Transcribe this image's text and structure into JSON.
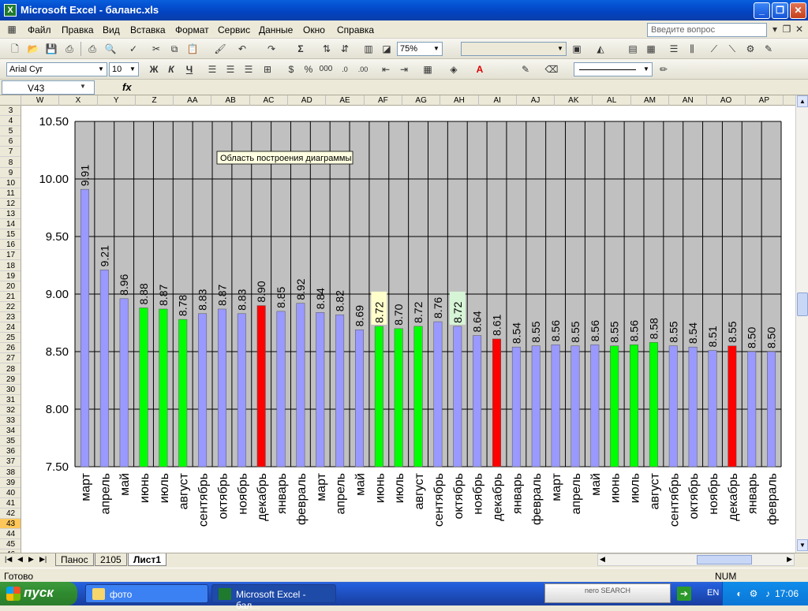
{
  "window": {
    "title": "Microsoft Excel - баланс.xls",
    "app_icon": "excel-icon",
    "buttons": [
      "minimize",
      "restore",
      "close"
    ]
  },
  "menu": {
    "items": [
      "Файл",
      "Правка",
      "Вид",
      "Вставка",
      "Формат",
      "Сервис",
      "Данные",
      "Окно",
      "Справка"
    ],
    "help_placeholder": "Введите вопрос"
  },
  "toolbar": {
    "zoom": "75%"
  },
  "format_toolbar": {
    "font": "Arial Cyr",
    "size": "10",
    "bold": "Ж",
    "italic": "К",
    "underline": "Ч"
  },
  "formula_bar": {
    "cell": "V43",
    "fx": "fx",
    "value": ""
  },
  "columns": [
    "W",
    "X",
    "Y",
    "Z",
    "AA",
    "AB",
    "AC",
    "AD",
    "AE",
    "AF",
    "AG",
    "AH",
    "AI",
    "AJ",
    "AK",
    "AL",
    "AM",
    "AN",
    "AO",
    "AP",
    "A"
  ],
  "rows_start": 3,
  "rows_end": 46,
  "selected_row": 43,
  "sheet_tabs": [
    "Панос",
    "2105",
    "Лист1"
  ],
  "active_tab": "Лист1",
  "status": {
    "ready": "Готово",
    "num": "NUM"
  },
  "taskbar": {
    "start": "пуск",
    "tasks": [
      "фото",
      "Microsoft Excel - бал..."
    ],
    "lang": "EN",
    "clock": "17:06",
    "nero": "nero SEARCH"
  },
  "tooltip": "Область построения диаграммы",
  "colors": {
    "bar_default": "#9999ff",
    "bar_green": "#00ff00",
    "bar_red": "#ff0000",
    "plot_bg": "#c0c0c0",
    "highlight_label": "#ffffcc"
  },
  "chart_data": {
    "type": "bar",
    "title": "",
    "xlabel": "",
    "ylabel": "",
    "ylim": [
      7.5,
      10.5
    ],
    "yticks": [
      "7.50",
      "8.00",
      "8.50",
      "9.00",
      "9.50",
      "10.00",
      "10.50"
    ],
    "grid": true,
    "categories": [
      "март",
      "апрель",
      "май",
      "июнь",
      "июль",
      "август",
      "сентябрь",
      "октябрь",
      "ноябрь",
      "декабрь",
      "январь",
      "февраль",
      "март",
      "апрель",
      "май",
      "июнь",
      "июль",
      "август",
      "сентябрь",
      "октябрь",
      "ноябрь",
      "декабрь",
      "январь",
      "февраль",
      "март",
      "апрель",
      "май",
      "июнь",
      "июль",
      "август",
      "сентябрь",
      "октябрь",
      "ноябрь",
      "декабрь",
      "январь",
      "февраль"
    ],
    "values": [
      9.91,
      9.21,
      8.96,
      8.88,
      8.87,
      8.78,
      8.83,
      8.87,
      8.83,
      8.9,
      8.85,
      8.92,
      8.84,
      8.82,
      8.69,
      8.72,
      8.7,
      8.72,
      8.76,
      8.72,
      8.64,
      8.61,
      8.54,
      8.55,
      8.56,
      8.55,
      8.56,
      8.55,
      8.56,
      8.58,
      8.55,
      8.54,
      8.51,
      8.55,
      8.5,
      8.5
    ],
    "labels": [
      "9.91",
      "9.21",
      "8.96",
      "8.88",
      "8.87",
      "8.78",
      "8.83",
      "8.87",
      "8.83",
      "8.90",
      "8.85",
      "8.92",
      "8.84",
      "8.82",
      "8.69",
      "8.72",
      "8.70",
      "8.72",
      "8.76",
      "8.72",
      "8.64",
      "8.61",
      "8.54",
      "8.55",
      "8.56",
      "8.55",
      "8.56",
      "8.55",
      "8.56",
      "8.58",
      "8.55",
      "8.54",
      "8.51",
      "8.55",
      "8.50",
      "8.50"
    ],
    "bar_colors": [
      "blue",
      "blue",
      "blue",
      "green",
      "green",
      "green",
      "blue",
      "blue",
      "blue",
      "red",
      "blue",
      "blue",
      "blue",
      "blue",
      "blue",
      "green",
      "green",
      "green",
      "blue",
      "blue",
      "blue",
      "red",
      "blue",
      "blue",
      "blue",
      "blue",
      "blue",
      "green",
      "green",
      "green",
      "blue",
      "blue",
      "blue",
      "red",
      "blue",
      "blue"
    ],
    "highlighted_labels": [
      15,
      19
    ]
  }
}
